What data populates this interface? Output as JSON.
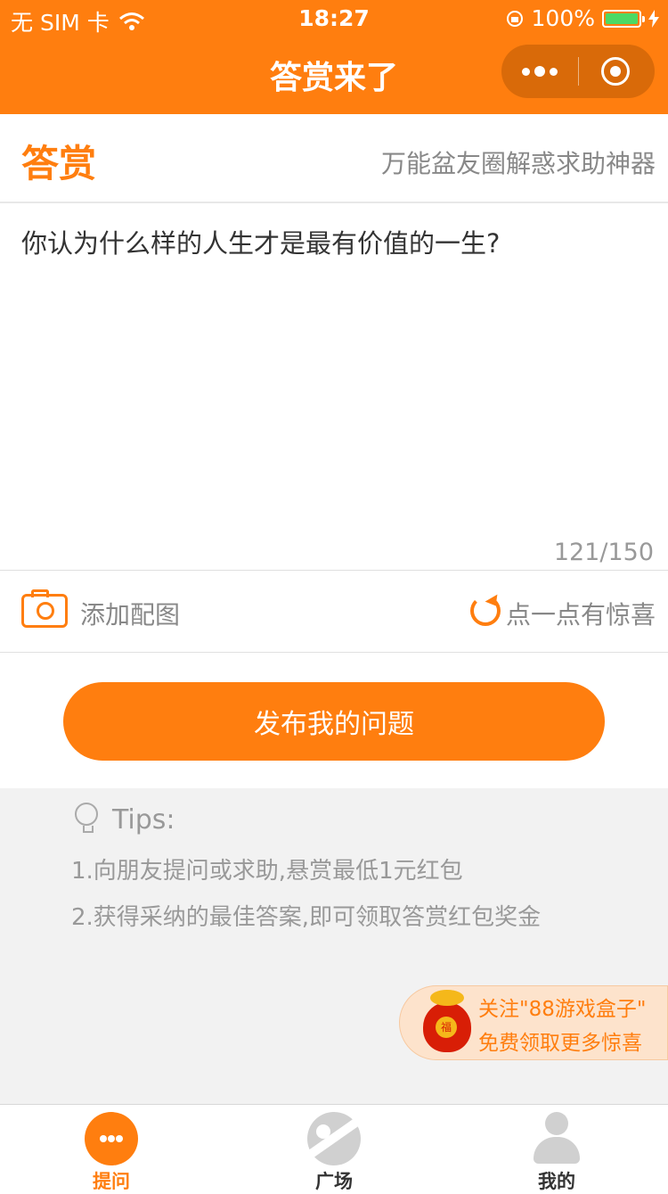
{
  "status_bar": {
    "carrier": "无 SIM 卡",
    "time": "18:27",
    "battery": "100%",
    "battery_level": 1.0
  },
  "nav": {
    "title": "答赏来了",
    "more_icon": "more-dots-icon",
    "close_icon": "target-circle-icon"
  },
  "header": {
    "brand": "答赏",
    "tagline": "万能盆友圈解惑求助神器"
  },
  "question": {
    "text": "你认为什么样的人生才是最有价值的一生?",
    "count": "121/150"
  },
  "actions": {
    "add_photo": "添加配图",
    "surprise": "点一点有惊喜"
  },
  "publish_button": "发布我的问题",
  "tips": {
    "title": "Tips:",
    "items": [
      "1.向朋友提问或求助,悬赏最低1元红包",
      "2.获得采纳的最佳答案,即可领取答赏红包奖金"
    ]
  },
  "promo": {
    "line1": "关注\"88游戏盒子\"",
    "line2": "免费领取更多惊喜",
    "coin_text": "福"
  },
  "tabbar": {
    "items": [
      {
        "label": "提问",
        "icon": "chat-bubble-icon",
        "active": true,
        "color": "#ff7e0f"
      },
      {
        "label": "广场",
        "icon": "planet-icon",
        "active": false,
        "color": "#333333"
      },
      {
        "label": "我的",
        "icon": "user-icon",
        "active": false,
        "color": "#333333"
      }
    ]
  },
  "colors": {
    "accent": "#ff7e0f",
    "tips_bg": "#f2f2f2",
    "muted_text": "#999999"
  }
}
